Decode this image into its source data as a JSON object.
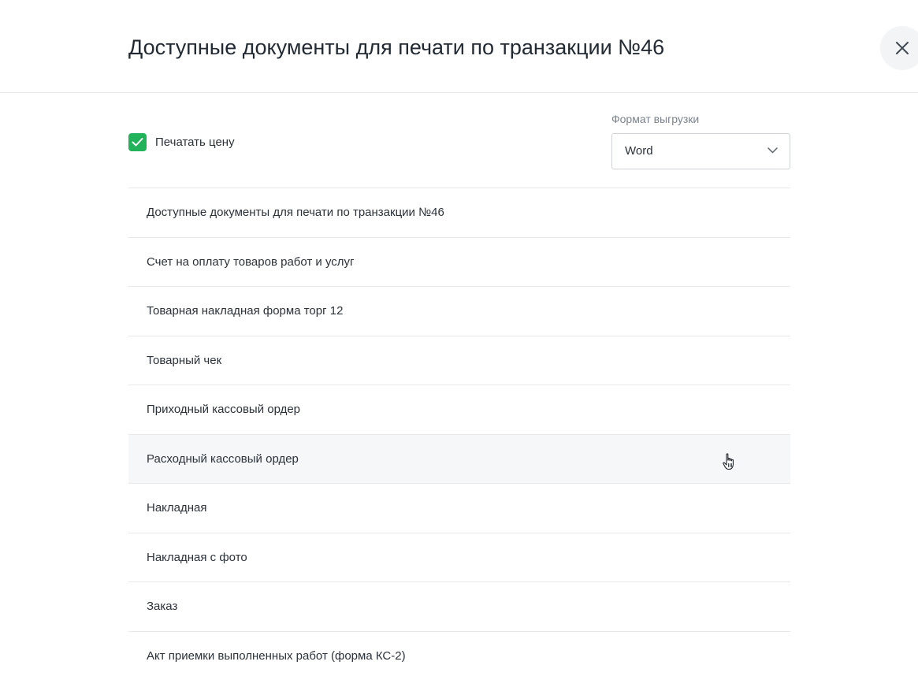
{
  "dialog": {
    "title": "Доступные документы для печати по транзакции №46",
    "close_icon": "close-icon"
  },
  "options": {
    "print_price": {
      "label": "Печатать цену",
      "checked": true,
      "accent_color": "#21b25a"
    },
    "format": {
      "label": "Формат выгрузки",
      "selected": "Word",
      "icon": "chevron-down-icon"
    }
  },
  "documents": [
    {
      "label": "Доступные документы для печати по транзакции №46"
    },
    {
      "label": "Счет на оплату товаров работ и услуг"
    },
    {
      "label": "Товарная накладная форма торг 12"
    },
    {
      "label": "Товарный чек"
    },
    {
      "label": "Приходный кассовый ордер"
    },
    {
      "label": "Расходный кассовый ордер",
      "hovered": true
    },
    {
      "label": "Накладная"
    },
    {
      "label": "Накладная с фото"
    },
    {
      "label": "Заказ"
    },
    {
      "label": "Акт приемки выполненных работ (форма КС-2)"
    }
  ]
}
